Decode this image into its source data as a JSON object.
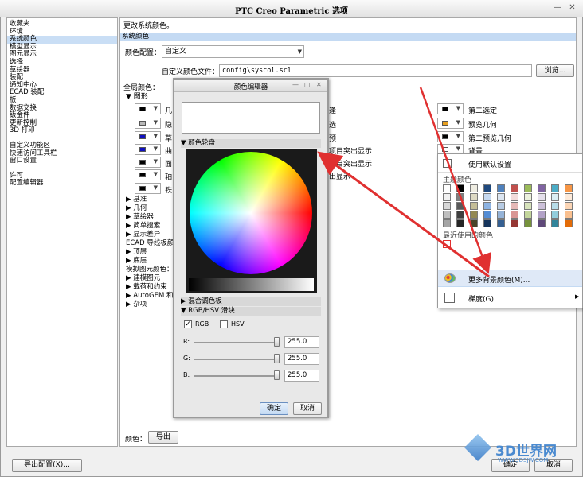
{
  "window": {
    "title": "PTC Creo Parametric 选项",
    "minimize": "—",
    "close": "✕"
  },
  "nav": {
    "group1": [
      "收藏夹",
      "环境",
      "系统颜色",
      "模型显示",
      "图元显示",
      "选择",
      "草绘器",
      "装配",
      "通知中心",
      "ECAD 装配",
      "板",
      "数据交换",
      "钣金件",
      "更新控制",
      "3D 打印"
    ],
    "selected_index": 2,
    "group2": [
      "自定义功能区",
      "快速访问工具栏",
      "窗口设置"
    ],
    "group3": [
      "许可",
      "配置编辑器"
    ]
  },
  "content": {
    "description": "更改系统颜色。",
    "section": "系统颜色",
    "scheme_label": "颜色配置：",
    "scheme_value": "自定义",
    "file_label": "自定义颜色文件：",
    "file_value": "config\\syscol.scl",
    "browse_btn": "浏览...",
    "global_colors": "全局颜色：",
    "graphics": "图形",
    "row_labels_left": [
      "几",
      "隐",
      "草",
      "曲",
      "面",
      "轴",
      "铁"
    ],
    "row_labels_mid": [
      "逢",
      "选",
      "预",
      "项目突出显示",
      "项目突出显示",
      "出显示",
      "突出显示"
    ],
    "right_rows": [
      "第二选定",
      "预览几何",
      "第二预览几何",
      "背景"
    ],
    "tree": [
      "基准",
      "几何",
      "草绘器",
      "简单搜索",
      "显示差异",
      "ECAD 导线板颜色",
      "顶层",
      "底层",
      "模拟图元颜色：",
      "建模图元",
      "载荷和约束",
      "AutoGEM 和",
      "杂项"
    ],
    "color_label": "颜色：",
    "export_btn": "导出",
    "export_config_btn": "导出配置(X)...",
    "ok_btn": "确定",
    "cancel_btn": "取消"
  },
  "color_editor": {
    "title": "颜色编辑器",
    "wheel_section": "颜色轮盘",
    "mix_section": "混合调色板",
    "rgb_section": "RGB/HSV 滑块",
    "rgb_check": "RGB",
    "hsv_check": "HSV",
    "r_label": "R:",
    "g_label": "G:",
    "b_label": "B:",
    "r": "255.0",
    "g": "255.0",
    "b": "255.0",
    "ok": "确定",
    "cancel": "取消"
  },
  "menu": {
    "default_item": "使用默认设置",
    "theme_colors": "主题颜色",
    "recent_colors": "最近使用的颜色",
    "more_colors": "更多背景颜色(M)...",
    "gradient": "梯度(G)"
  },
  "watermark": {
    "brand": "3D世界网",
    "url": "WWW.3DSJW.COM"
  },
  "colors": {
    "selection_blue": "#c4daf3",
    "arrow_red": "#e03030",
    "theme_palette": [
      [
        "#ffffff",
        "#000000",
        "#eeece1",
        "#1f497d",
        "#4f81bd",
        "#c0504d",
        "#9bbb59",
        "#8064a2",
        "#4bacc6",
        "#f79646"
      ],
      [
        "#f2f2f2",
        "#7f7f7f",
        "#ddd9c3",
        "#c6d9f0",
        "#dbe5f1",
        "#f2dcdb",
        "#ebf1dd",
        "#e5e0ec",
        "#dbeef3",
        "#fdeada"
      ],
      [
        "#d8d8d8",
        "#595959",
        "#c4bd97",
        "#8db3e2",
        "#b8cce4",
        "#e5b9b7",
        "#d7e3bc",
        "#ccc1d9",
        "#b7dde8",
        "#fbd5b5"
      ],
      [
        "#bfbfbf",
        "#3f3f3f",
        "#938953",
        "#548dd4",
        "#95b3d7",
        "#d99694",
        "#c3d69b",
        "#b2a2c7",
        "#92cddc",
        "#fac08f"
      ],
      [
        "#a5a5a5",
        "#262626",
        "#494429",
        "#17365d",
        "#366092",
        "#953734",
        "#76923c",
        "#5f497a",
        "#31859b",
        "#e36c09"
      ]
    ]
  }
}
